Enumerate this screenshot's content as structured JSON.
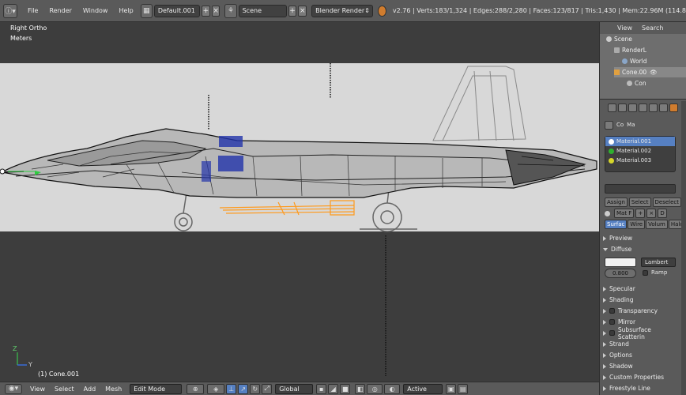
{
  "header": {
    "menus": [
      "File",
      "Render",
      "Window",
      "Help"
    ],
    "screen_layout": "Default.001",
    "scene": "Scene",
    "render_engine": "Blender Render",
    "stats": "v2.76 | Verts:183/1,324 | Edges:288/2,280 | Faces:123/817 | Tris:1,430 | Mem:22.96M (114.8"
  },
  "viewport": {
    "view_name": "Right Ortho",
    "units": "Meters",
    "object_info": "(1) Cone.001",
    "axis_y": "Y",
    "axis_z": "Z"
  },
  "footer": {
    "menus": [
      "View",
      "Select",
      "Add",
      "Mesh"
    ],
    "mode": "Edit Mode",
    "orientation": "Global",
    "pivot": "Active"
  },
  "outliner": {
    "tabs": [
      "View",
      "Search"
    ],
    "items": [
      "Scene",
      "RenderL",
      "World",
      "Cone.00",
      "Con"
    ]
  },
  "properties": {
    "context_items": [
      "Co",
      "Ma"
    ],
    "materials": [
      "Material.001",
      "Material.002",
      "Material.003"
    ],
    "material_colors": [
      "#ffffff",
      "#2fb12f",
      "#d6d62a"
    ],
    "buttons": [
      "Assign",
      "Select",
      "Deselect"
    ],
    "material_name": "Mat F",
    "data_tag": "D",
    "surface_tabs": [
      "Surfac",
      "Wire",
      "Volum",
      "Halo"
    ],
    "diffuse_shader": "Lambert",
    "intensity": "0.800",
    "ramp_label": "Ramp",
    "sections": [
      "Preview",
      "Diffuse",
      "Specular",
      "Shading",
      "Transparency",
      "Mirror",
      "Subsurface Scatterin",
      "Strand",
      "Options",
      "Shadow",
      "Custom Properties",
      "Freestyle Line"
    ]
  },
  "colors": {
    "accent": "#5680c2",
    "selection_orange": "#ff9a1c",
    "ref_background": "#d8d8d8"
  }
}
